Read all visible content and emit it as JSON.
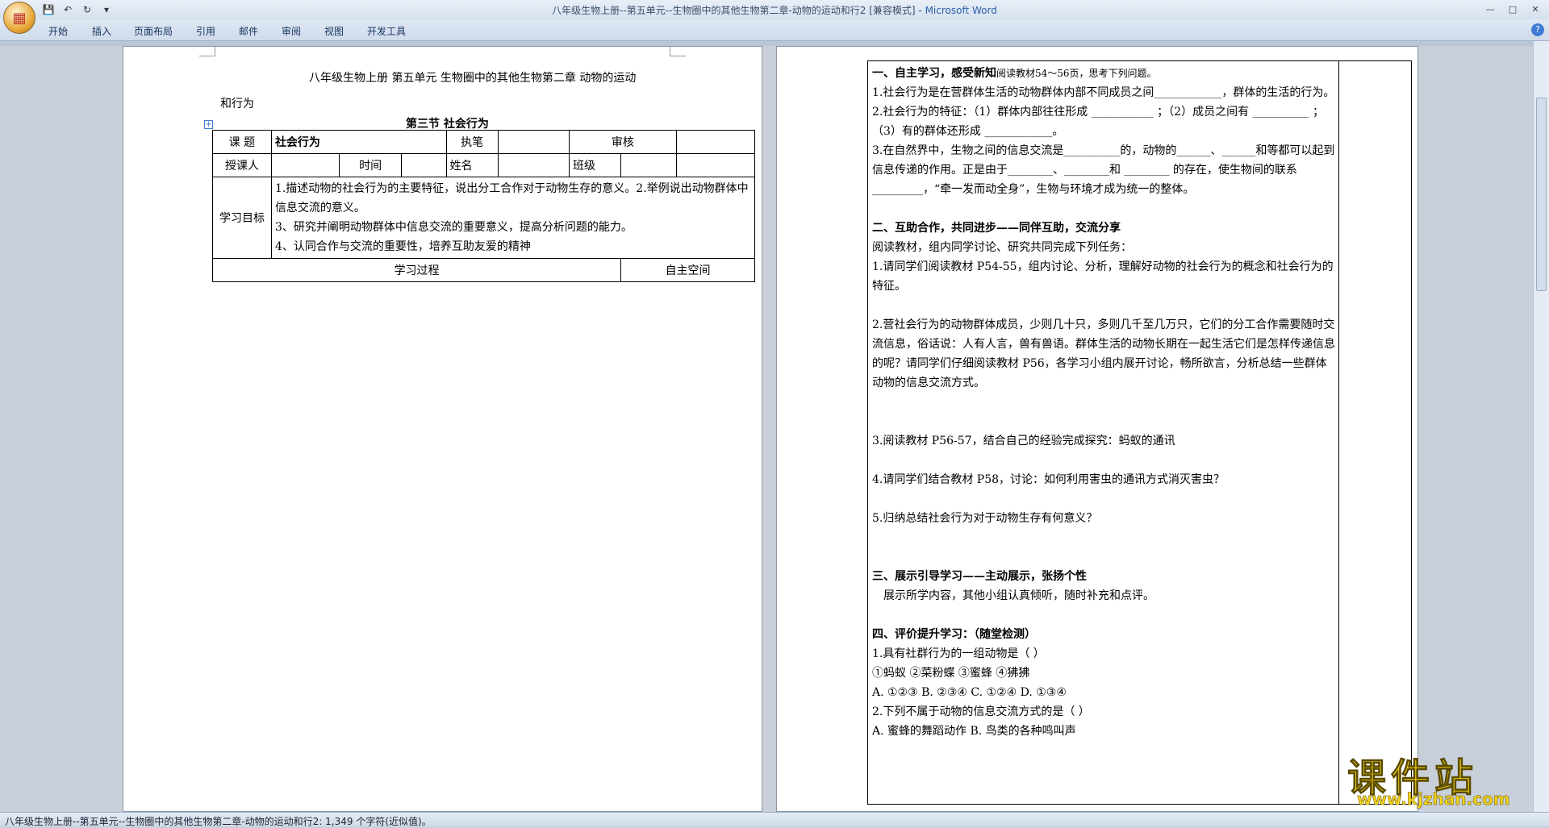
{
  "window": {
    "title": "八年级生物上册--第五单元--生物圈中的其他生物第二章-动物的运动和行2 [兼容模式]",
    "app": "Microsoft Word"
  },
  "ribbon_tabs": [
    "开始",
    "插入",
    "页面布局",
    "引用",
    "邮件",
    "审阅",
    "视图",
    "开发工具"
  ],
  "page1": {
    "header_line1": "八年级生物上册   第五单元   生物圈中的其他生物第二章  动物的运动",
    "header_line2": "和行为",
    "section": "第三节   社会行为",
    "table": {
      "topic_label": "课   题",
      "topic_value": "社会行为",
      "writer_label": "执笔",
      "review_label": "审核",
      "teacher_label": "授课人",
      "time_label": "时间",
      "name_label": "姓名",
      "class_label": "班级",
      "goals_label": "学习目标",
      "goal1": "1.描述动物的社会行为的主要特征，说出分工合作对于动物生存的意义。2.举例说出动物群体中信息交流的意义。",
      "goal3": "3、研究并阐明动物群体中信息交流的重要意义，提高分析问题的能力。",
      "goal4": "4、认同合作与交流的重要性，培养互助友爱的精神",
      "process_label": "学习过程",
      "space_label": "自主空间"
    }
  },
  "page2": {
    "s1_title": "一、自主学习，感受新知",
    "s1_note": "阅读教材54～56页，思考下列问题。",
    "q1": "1.社会行为是在营群体生活的动物群体内部不同成员之间____________，群体的生活的行为。",
    "q2": "2.社会行为的特征：（1）群体内部往往形成 ___________ ；（2）成员之间有 __________ ；（3）有的群体还形成 ____________。",
    "q3": "3.在自然界中，生物之间的信息交流是__________的，动物的______、______和等都可以起到信息传递的作用。正是由于________、________和 ________ 的存在，使生物间的联系 _________，“牵一发而动全身”，生物与环境才成为统一的整体。",
    "s2_title": "二、互助合作，共同进步——同伴互助，交流分享",
    "s2_intro": "阅读教材，组内同学讨论、研究共同完成下列任务：",
    "t1": "1.请同学们阅读教材 P54-55，组内讨论、分析，理解好动物的社会行为的概念和社会行为的特征。",
    "t2": "2.营社会行为的动物群体成员，少则几十只，多则几千至几万只，它们的分工合作需要随时交流信息，俗话说：人有人言，兽有兽语。群体生活的动物长期在一起生活它们是怎样传递信息的呢？请同学们仔细阅读教材 P56，各学习小组内展开讨论，畅所欲言，分析总结一些群体动物的信息交流方式。",
    "t3": "3.阅读教材 P56-57，结合自己的经验完成探究：蚂蚁的通讯",
    "t4": "4.请同学们结合教材 P58，讨论：如何利用害虫的通讯方式消灭害虫？",
    "t5": "5.归纳总结社会行为对于动物生存有何意义？",
    "s3_title": "三、展示引导学习——主动展示，张扬个性",
    "s3_body": "展示所学内容，其他小组认真倾听，随时补充和点评。",
    "s4_title": "四、评价提升学习：（随堂检测）",
    "e1": "1.具有社群行为的一组动物是（        ）",
    "e1_opts": "①蚂蚁        ②菜粉蝶        ③蜜蜂        ④狒狒",
    "e1_choices": "A. ①②③          B. ②③④          C. ①②④          D. ①③④",
    "e2": "2.下列不属于动物的信息交流方式的是（        ）",
    "e2_choices": "A. 蜜蜂的舞蹈动作                    B. 鸟类的各种鸣叫声"
  },
  "statusbar": {
    "text": "八年级生物上册--第五单元--生物圈中的其他生物第二章-动物的运动和行2: 1,349 个字符(近似值)。"
  },
  "watermark": {
    "big": "课件站",
    "url": "www.kjzhan.com"
  }
}
